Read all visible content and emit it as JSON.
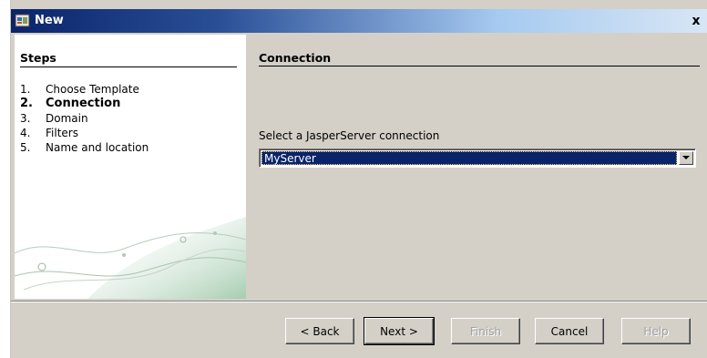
{
  "window": {
    "title": "New",
    "close_label": "x",
    "icon": "wizard-icon",
    "colors": {
      "titlebar_start": "#0a246a",
      "titlebar_end": "#d8e6f5",
      "selection": "#0a246a",
      "dialog_bg": "#d4d0c8"
    }
  },
  "sidebar": {
    "title": "Steps",
    "steps": [
      {
        "num": "1.",
        "label": "Choose Template",
        "current": false
      },
      {
        "num": "2.",
        "label": "Connection",
        "current": true
      },
      {
        "num": "3.",
        "label": "Domain",
        "current": false
      },
      {
        "num": "4.",
        "label": "Filters",
        "current": false
      },
      {
        "num": "5.",
        "label": "Name and location",
        "current": false
      }
    ]
  },
  "content": {
    "title": "Connection",
    "connection_label": "Select a JasperServer connection",
    "connection_selected": "MyServer"
  },
  "buttons": {
    "back": "< Back",
    "next": "Next >",
    "finish": "Finish",
    "cancel": "Cancel",
    "help": "Help"
  }
}
